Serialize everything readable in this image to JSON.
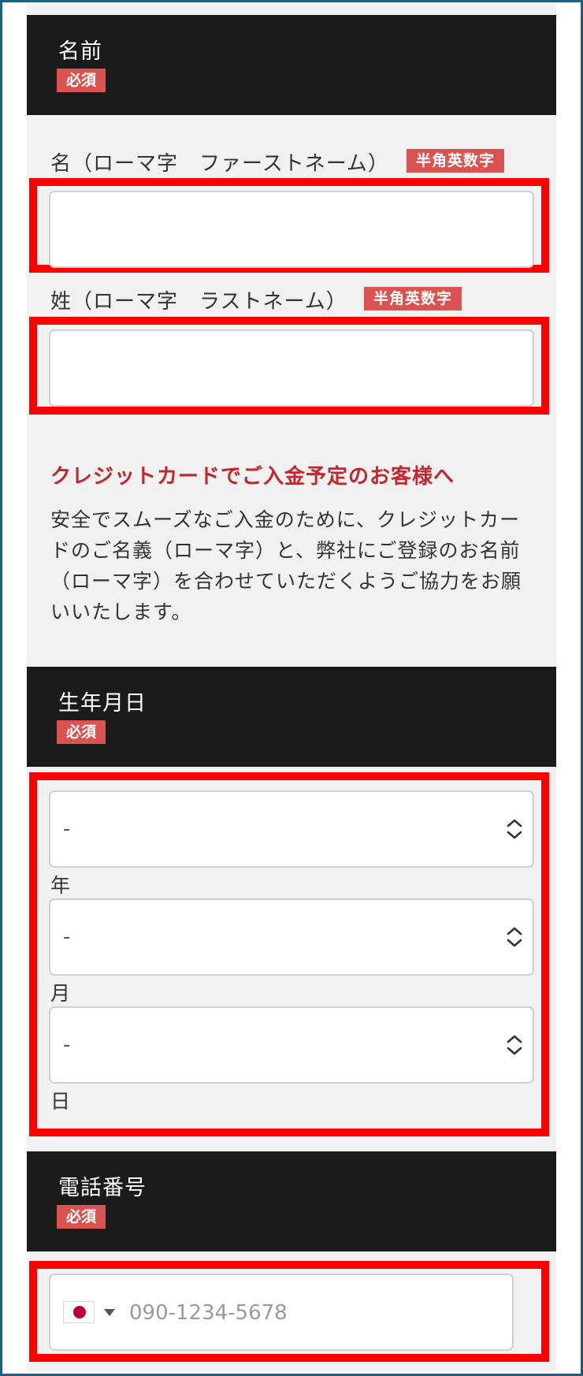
{
  "name_section": {
    "title": "名前",
    "required_badge": "必須",
    "first_name_label": "名（ローマ字　ファーストネーム）",
    "first_name_badge": "半角英数字",
    "first_name_value": "",
    "last_name_label": "姓（ローマ字　ラストネーム）",
    "last_name_badge": "半角英数字",
    "last_name_value": ""
  },
  "notice": {
    "title": "クレジットカードでご入金予定のお客様へ",
    "body": "安全でスムーズなご入金のために、クレジットカードのご名義（ローマ字）と、弊社にご登録のお名前（ローマ字）を合わせていただくようご協力をお願いいたします。"
  },
  "birthdate_section": {
    "title": "生年月日",
    "required_badge": "必須",
    "year_value": "-",
    "year_label": "年",
    "month_value": "-",
    "month_label": "月",
    "day_value": "-",
    "day_label": "日"
  },
  "phone_section": {
    "title": "電話番号",
    "required_badge": "必須",
    "country_flag": "japan-flag-icon",
    "placeholder": "090-1234-5678"
  },
  "colors": {
    "header_bg": "#1b1b1b",
    "badge_bg": "#db5350",
    "highlight": "#ff0000",
    "notice_title": "#c2272d",
    "page_bg": "#f1f1f1"
  }
}
